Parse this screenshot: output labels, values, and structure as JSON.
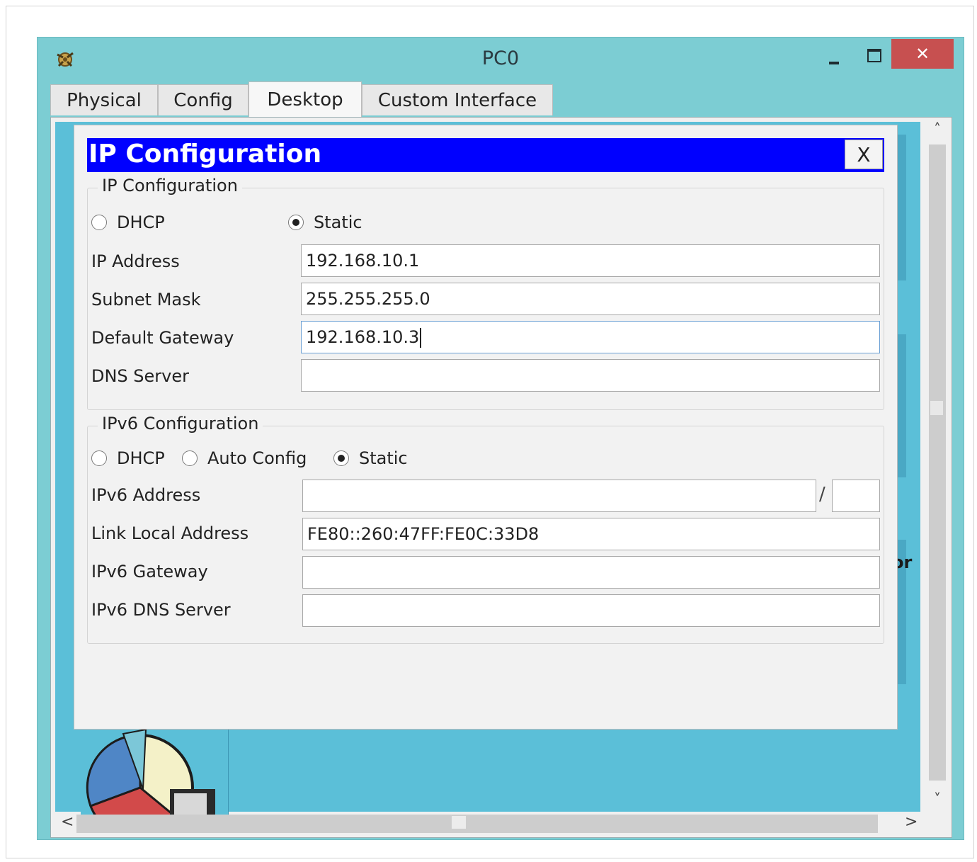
{
  "window": {
    "title": "PC0",
    "close_glyph": "✕"
  },
  "tabs": [
    {
      "label": "Physical",
      "active": false
    },
    {
      "label": "Config",
      "active": false
    },
    {
      "label": "Desktop",
      "active": true
    },
    {
      "label": "Custom Interface",
      "active": false
    }
  ],
  "background_text": {
    "partial_label": "or"
  },
  "dialog": {
    "title": "IP Configuration",
    "close_label": "X",
    "ipv4": {
      "group_label": "IP Configuration",
      "dhcp_label": "DHCP",
      "static_label": "Static",
      "selected": "Static",
      "ip_address_label": "IP Address",
      "ip_address_value": "192.168.10.1",
      "subnet_mask_label": "Subnet Mask",
      "subnet_mask_value": "255.255.255.0",
      "default_gateway_label": "Default Gateway",
      "default_gateway_value": "192.168.10.3",
      "dns_server_label": "DNS Server",
      "dns_server_value": ""
    },
    "ipv6": {
      "group_label": "IPv6 Configuration",
      "dhcp_label": "DHCP",
      "auto_config_label": "Auto Config",
      "static_label": "Static",
      "selected": "Static",
      "address_label": "IPv6 Address",
      "address_value": "",
      "prefix_separator": "/",
      "prefix_value": "",
      "link_local_label": "Link Local Address",
      "link_local_value": "FE80::260:47FF:FE0C:33D8",
      "gateway_label": "IPv6 Gateway",
      "gateway_value": "",
      "dns_server_label": "IPv6 DNS Server",
      "dns_server_value": ""
    }
  },
  "scrollbars": {
    "up_arrow": "˄",
    "down_arrow": "˅",
    "left_arrow": "<",
    "right_arrow": ">"
  },
  "colors": {
    "window_frame": "#7ccdd3",
    "desktop_background": "#5bbfd8",
    "dialog_title_bar": "#0000ff",
    "close_button": "#c75050"
  },
  "icons": {
    "app_icon": "packet-tracer-icon",
    "desktop_app_icon": "pie-chart-icon"
  }
}
